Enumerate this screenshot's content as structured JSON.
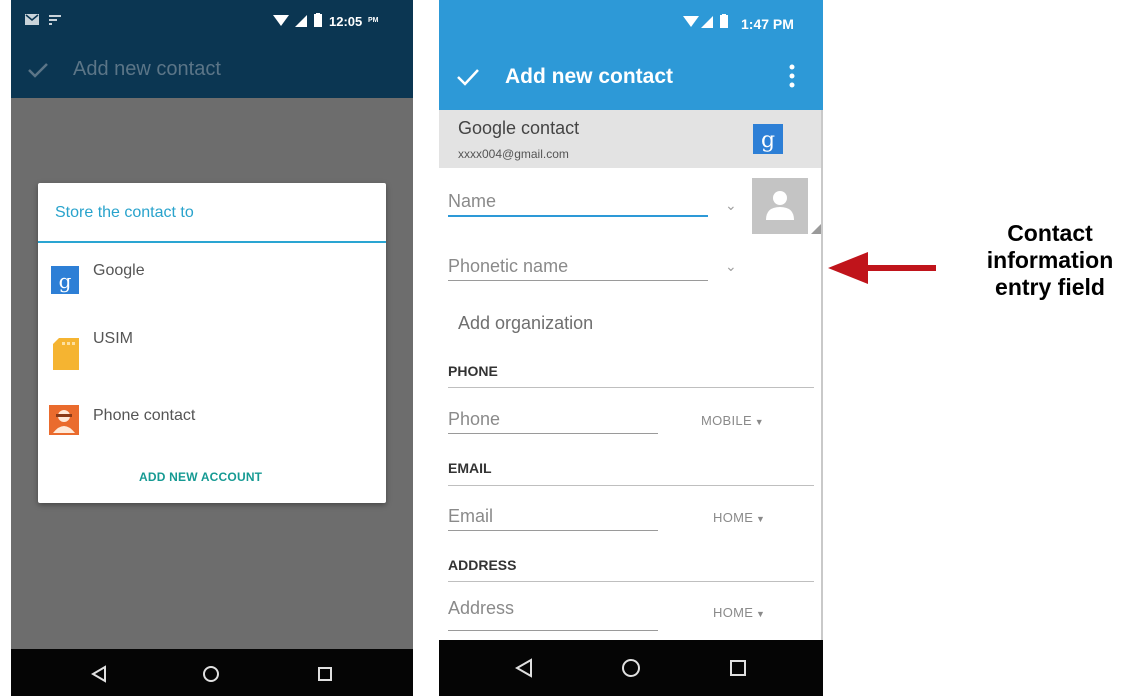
{
  "left_screen": {
    "status_time": "12:05",
    "status_ampm": "PM",
    "app_title": "Add new contact",
    "dialog": {
      "title": "Store the contact to",
      "options": [
        {
          "label": "Google",
          "icon": "google-icon"
        },
        {
          "label": "USIM",
          "icon": "sim-card-icon"
        },
        {
          "label": "Phone contact",
          "icon": "phone-contact-icon"
        }
      ],
      "add_account": "ADD NEW ACCOUNT"
    }
  },
  "right_screen": {
    "status_time": "1:47 PM",
    "app_title": "Add new contact",
    "account": {
      "title": "Google contact",
      "email": "xxxx004@gmail.com",
      "badge": "g"
    },
    "fields": {
      "name_placeholder": "Name",
      "phonetic_placeholder": "Phonetic name",
      "organization": "Add organization",
      "phone_header": "PHONE",
      "phone_placeholder": "Phone",
      "phone_type": "MOBILE",
      "email_header": "EMAIL",
      "email_placeholder": "Email",
      "email_type": "HOME",
      "address_header": "ADDRESS",
      "address_placeholder": "Address",
      "address_type": "HOME"
    }
  },
  "annotation": {
    "line1": "Contact",
    "line2": "information",
    "line3": "entry field",
    "arrow_color": "#c0141b"
  },
  "colors": {
    "left_bar": "#0b3652",
    "right_bar": "#2d99d7",
    "dialog_accent": "#29a3cc",
    "add_account": "#169a93"
  }
}
